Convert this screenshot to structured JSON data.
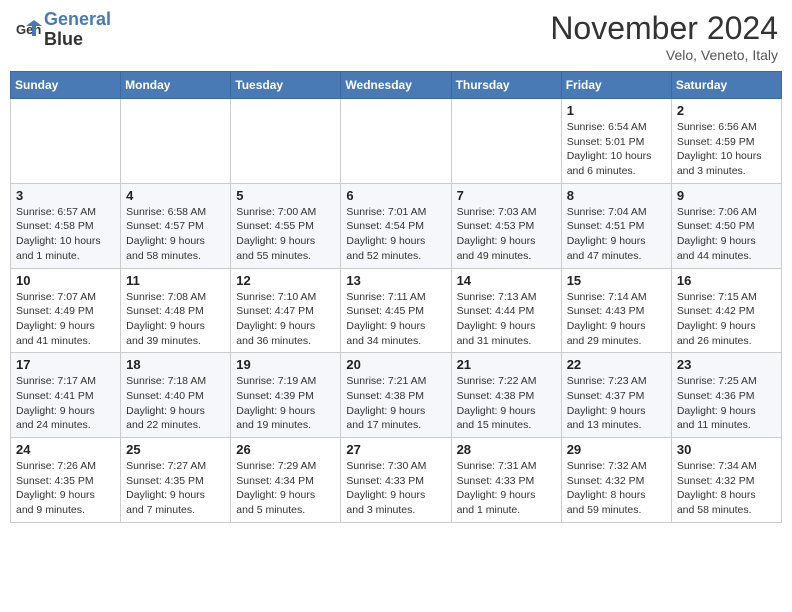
{
  "header": {
    "logo_line1": "General",
    "logo_line2": "Blue",
    "month_title": "November 2024",
    "subtitle": "Velo, Veneto, Italy"
  },
  "weekdays": [
    "Sunday",
    "Monday",
    "Tuesday",
    "Wednesday",
    "Thursday",
    "Friday",
    "Saturday"
  ],
  "weeks": [
    [
      {
        "day": "",
        "info": ""
      },
      {
        "day": "",
        "info": ""
      },
      {
        "day": "",
        "info": ""
      },
      {
        "day": "",
        "info": ""
      },
      {
        "day": "",
        "info": ""
      },
      {
        "day": "1",
        "info": "Sunrise: 6:54 AM\nSunset: 5:01 PM\nDaylight: 10 hours and 6 minutes."
      },
      {
        "day": "2",
        "info": "Sunrise: 6:56 AM\nSunset: 4:59 PM\nDaylight: 10 hours and 3 minutes."
      }
    ],
    [
      {
        "day": "3",
        "info": "Sunrise: 6:57 AM\nSunset: 4:58 PM\nDaylight: 10 hours and 1 minute."
      },
      {
        "day": "4",
        "info": "Sunrise: 6:58 AM\nSunset: 4:57 PM\nDaylight: 9 hours and 58 minutes."
      },
      {
        "day": "5",
        "info": "Sunrise: 7:00 AM\nSunset: 4:55 PM\nDaylight: 9 hours and 55 minutes."
      },
      {
        "day": "6",
        "info": "Sunrise: 7:01 AM\nSunset: 4:54 PM\nDaylight: 9 hours and 52 minutes."
      },
      {
        "day": "7",
        "info": "Sunrise: 7:03 AM\nSunset: 4:53 PM\nDaylight: 9 hours and 49 minutes."
      },
      {
        "day": "8",
        "info": "Sunrise: 7:04 AM\nSunset: 4:51 PM\nDaylight: 9 hours and 47 minutes."
      },
      {
        "day": "9",
        "info": "Sunrise: 7:06 AM\nSunset: 4:50 PM\nDaylight: 9 hours and 44 minutes."
      }
    ],
    [
      {
        "day": "10",
        "info": "Sunrise: 7:07 AM\nSunset: 4:49 PM\nDaylight: 9 hours and 41 minutes."
      },
      {
        "day": "11",
        "info": "Sunrise: 7:08 AM\nSunset: 4:48 PM\nDaylight: 9 hours and 39 minutes."
      },
      {
        "day": "12",
        "info": "Sunrise: 7:10 AM\nSunset: 4:47 PM\nDaylight: 9 hours and 36 minutes."
      },
      {
        "day": "13",
        "info": "Sunrise: 7:11 AM\nSunset: 4:45 PM\nDaylight: 9 hours and 34 minutes."
      },
      {
        "day": "14",
        "info": "Sunrise: 7:13 AM\nSunset: 4:44 PM\nDaylight: 9 hours and 31 minutes."
      },
      {
        "day": "15",
        "info": "Sunrise: 7:14 AM\nSunset: 4:43 PM\nDaylight: 9 hours and 29 minutes."
      },
      {
        "day": "16",
        "info": "Sunrise: 7:15 AM\nSunset: 4:42 PM\nDaylight: 9 hours and 26 minutes."
      }
    ],
    [
      {
        "day": "17",
        "info": "Sunrise: 7:17 AM\nSunset: 4:41 PM\nDaylight: 9 hours and 24 minutes."
      },
      {
        "day": "18",
        "info": "Sunrise: 7:18 AM\nSunset: 4:40 PM\nDaylight: 9 hours and 22 minutes."
      },
      {
        "day": "19",
        "info": "Sunrise: 7:19 AM\nSunset: 4:39 PM\nDaylight: 9 hours and 19 minutes."
      },
      {
        "day": "20",
        "info": "Sunrise: 7:21 AM\nSunset: 4:38 PM\nDaylight: 9 hours and 17 minutes."
      },
      {
        "day": "21",
        "info": "Sunrise: 7:22 AM\nSunset: 4:38 PM\nDaylight: 9 hours and 15 minutes."
      },
      {
        "day": "22",
        "info": "Sunrise: 7:23 AM\nSunset: 4:37 PM\nDaylight: 9 hours and 13 minutes."
      },
      {
        "day": "23",
        "info": "Sunrise: 7:25 AM\nSunset: 4:36 PM\nDaylight: 9 hours and 11 minutes."
      }
    ],
    [
      {
        "day": "24",
        "info": "Sunrise: 7:26 AM\nSunset: 4:35 PM\nDaylight: 9 hours and 9 minutes."
      },
      {
        "day": "25",
        "info": "Sunrise: 7:27 AM\nSunset: 4:35 PM\nDaylight: 9 hours and 7 minutes."
      },
      {
        "day": "26",
        "info": "Sunrise: 7:29 AM\nSunset: 4:34 PM\nDaylight: 9 hours and 5 minutes."
      },
      {
        "day": "27",
        "info": "Sunrise: 7:30 AM\nSunset: 4:33 PM\nDaylight: 9 hours and 3 minutes."
      },
      {
        "day": "28",
        "info": "Sunrise: 7:31 AM\nSunset: 4:33 PM\nDaylight: 9 hours and 1 minute."
      },
      {
        "day": "29",
        "info": "Sunrise: 7:32 AM\nSunset: 4:32 PM\nDaylight: 8 hours and 59 minutes."
      },
      {
        "day": "30",
        "info": "Sunrise: 7:34 AM\nSunset: 4:32 PM\nDaylight: 8 hours and 58 minutes."
      }
    ]
  ]
}
